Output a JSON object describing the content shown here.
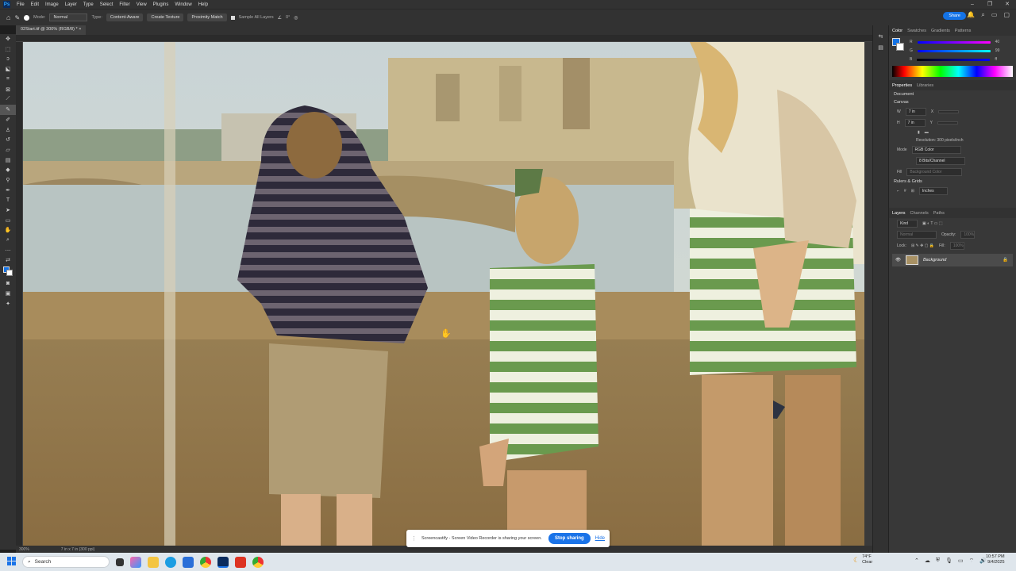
{
  "menu": {
    "items": [
      "File",
      "Edit",
      "Image",
      "Layer",
      "Type",
      "Select",
      "Filter",
      "View",
      "Plugins",
      "Window",
      "Help"
    ]
  },
  "options": {
    "mode_label": "Mode:",
    "mode_value": "Normal",
    "type_label": "Type:",
    "type_buttons": [
      "Content-Aware",
      "Create Texture",
      "Proximity Match"
    ],
    "sample_all": "Sample All Layers",
    "angle": "0°",
    "share": "Share"
  },
  "document": {
    "tab": "02Start.tif @ 300% (RGB/8) *",
    "zoom": "300%",
    "size": "7 in x 7 in (300 ppi)"
  },
  "panel_tabs": {
    "color": [
      "Color",
      "Swatches",
      "Gradients",
      "Patterns"
    ],
    "properties": [
      "Properties",
      "Libraries"
    ],
    "layers": [
      "Layers",
      "Channels",
      "Paths"
    ]
  },
  "color": {
    "r": "40",
    "g": "99",
    "b": "ff"
  },
  "properties": {
    "type": "Document",
    "canvas": "Canvas",
    "w_label": "W",
    "w": "7 in",
    "h_label": "H",
    "h": "7 in",
    "x_label": "X",
    "y_label": "Y",
    "resolution": "Resolution: 300 pixels/inch",
    "mode_label": "Mode",
    "mode": "RGB Color",
    "depth": "8 Bits/Channel",
    "fill_label": "Fill",
    "fill": "Background Color",
    "rulers": "Rulers & Grids",
    "units": "Inches"
  },
  "layers": {
    "kind": "Kind",
    "blend": "Normal",
    "opacity_label": "Opacity:",
    "opacity": "100%",
    "fill_label": "Fill:",
    "fill": "100%",
    "lock_label": "Lock:",
    "layer_name": "Background"
  },
  "toast": {
    "message": "Screencastify - Screen Video Recorder is sharing your screen.",
    "stop": "Stop sharing",
    "hide": "Hide"
  },
  "taskbar": {
    "search": "Search",
    "weather_temp": "74°F",
    "weather_cond": "Clear",
    "time": "10:57 PM",
    "date": "9/4/2025"
  },
  "colors": {
    "accent": "#1473e6",
    "ps_blue": "#31a8ff",
    "panel": "#383838",
    "chrome": "#323232"
  }
}
